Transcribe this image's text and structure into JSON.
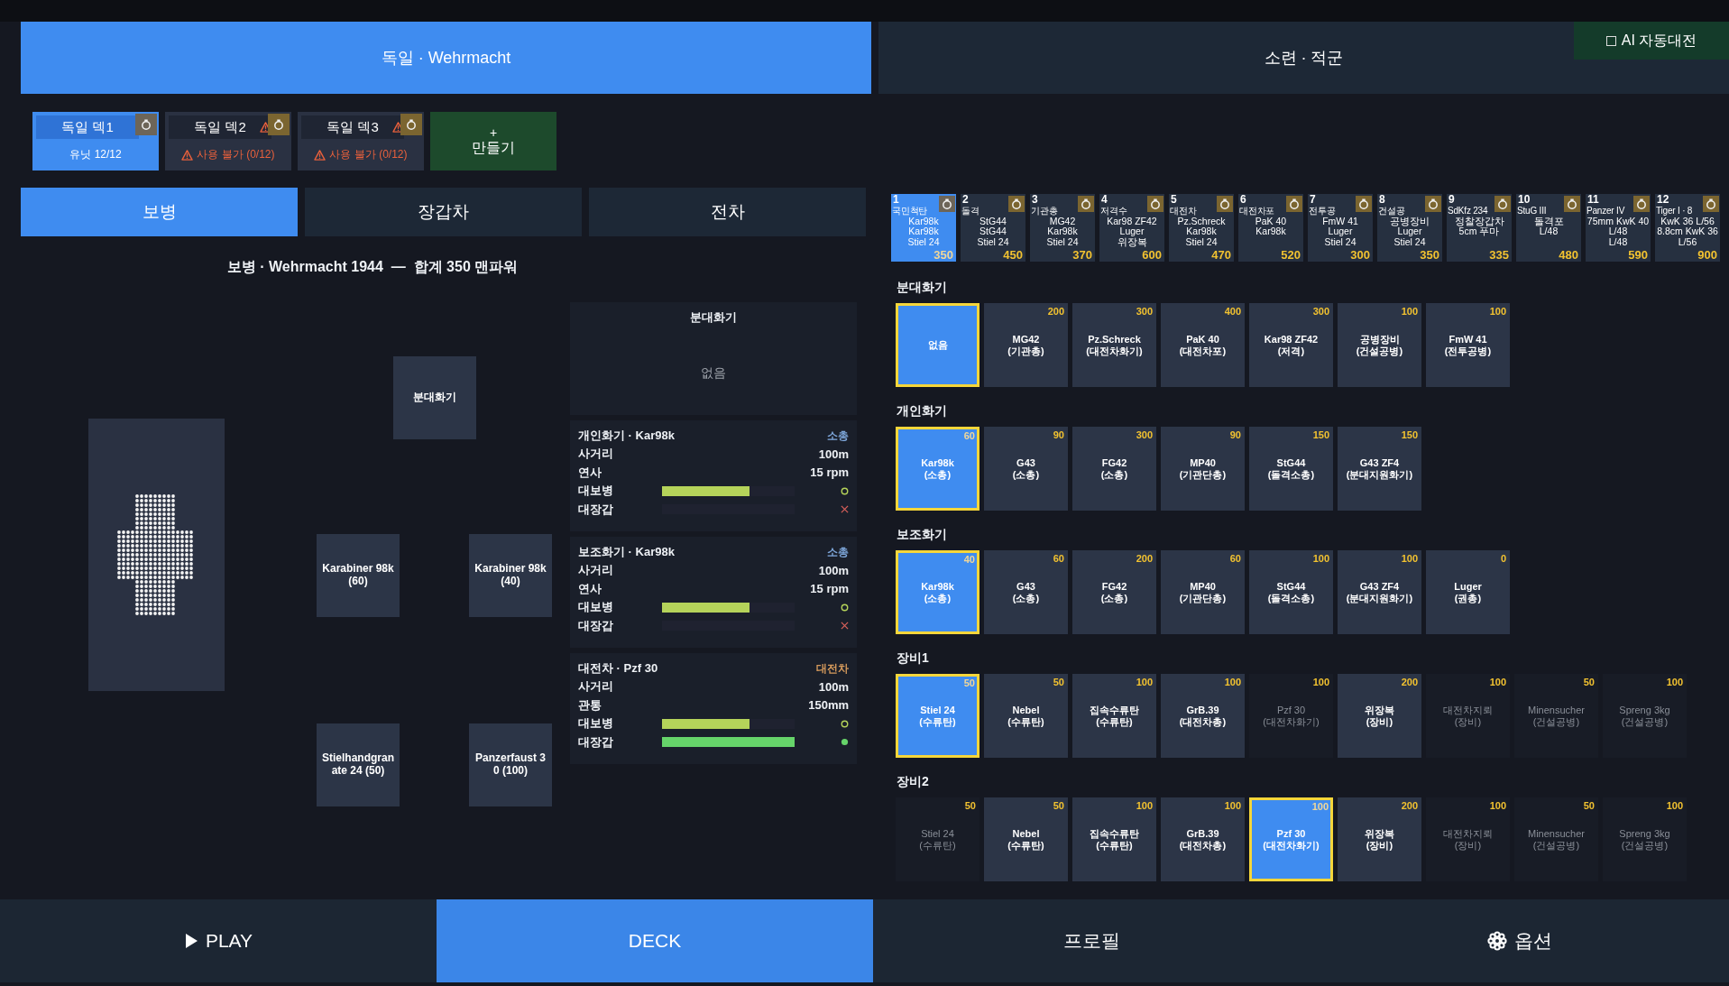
{
  "factions": [
    {
      "label": "독일 · Wehrmacht",
      "selected": true
    },
    {
      "label": "소련 · 적군",
      "selected": false
    }
  ],
  "ai_auto": {
    "label": "AI 자동대전",
    "checked": false
  },
  "decks": [
    {
      "name": "독일 덱1",
      "status": "유닛 12/12",
      "warning": false,
      "selected": true
    },
    {
      "name": "독일 덱2",
      "status": "사용 불가 (0/12)",
      "warning": true,
      "selected": false
    },
    {
      "name": "독일 덱3",
      "status": "사용 불가 (0/12)",
      "warning": true,
      "selected": false
    }
  ],
  "new_deck": {
    "plus": "+",
    "label": "만들기"
  },
  "unit_tabs": [
    {
      "label": "보병",
      "selected": true
    },
    {
      "label": "장갑차",
      "selected": false
    },
    {
      "label": "전차",
      "selected": false
    }
  ],
  "summary": "보병 · Wehrmacht 1944  —  합계 350 맨파워",
  "squad": {
    "rows": [
      [
        {
          "label": "분대화기"
        }
      ],
      [
        {
          "label": "Karabiner 98k (60)"
        },
        {
          "label": "Karabiner 98k (40)"
        }
      ],
      [
        {
          "label": "Stielhandgranate 24 (50)"
        },
        {
          "label": "Panzerfaust 30 (100)"
        }
      ]
    ]
  },
  "squad_weapon_panel": {
    "title": "분대화기",
    "empty_text": "없음"
  },
  "weapon_cards": [
    {
      "title": "개인화기 · Kar98k",
      "class": "소총",
      "color": "#7fa8dc",
      "stats": [
        {
          "kind": "text",
          "label": "사거리",
          "value": "100m"
        },
        {
          "kind": "text",
          "label": "연사",
          "value": "15 rpm"
        },
        {
          "kind": "bar",
          "label": "대보병",
          "level": 0.66,
          "color": "#b5d35a"
        },
        {
          "kind": "bar",
          "label": "대장갑",
          "level": 0,
          "color": "#d8605a"
        }
      ]
    },
    {
      "title": "보조화기 · Kar98k",
      "class": "소총",
      "color": "#7fa8dc",
      "stats": [
        {
          "kind": "text",
          "label": "사거리",
          "value": "100m"
        },
        {
          "kind": "text",
          "label": "연사",
          "value": "15 rpm"
        },
        {
          "kind": "bar",
          "label": "대보병",
          "level": 0.66,
          "color": "#b5d35a"
        },
        {
          "kind": "bar",
          "label": "대장갑",
          "level": 0,
          "color": "#d8605a"
        }
      ]
    },
    {
      "title": "대전차 · Pzf 30",
      "class": "대전차",
      "color": "#d59a5c",
      "stats": [
        {
          "kind": "text",
          "label": "사거리",
          "value": "100m"
        },
        {
          "kind": "text",
          "label": "관통",
          "value": "150mm"
        },
        {
          "kind": "bar",
          "label": "대보병",
          "level": 0.66,
          "color": "#b5d35a"
        },
        {
          "kind": "bar",
          "label": "대장갑",
          "level": 1,
          "color": "#66d46a"
        }
      ]
    }
  ],
  "unit_strip": [
    {
      "index": "1",
      "lines": [
        "국민척탄",
        "Kar98k",
        "Kar98k",
        "Stiel 24"
      ],
      "cost": "350",
      "selected": true
    },
    {
      "index": "2",
      "lines": [
        "돌격",
        "StG44",
        "StG44",
        "Stiel 24"
      ],
      "cost": "450",
      "selected": false
    },
    {
      "index": "3",
      "lines": [
        "기관총",
        "MG42",
        "Kar98k",
        "Stiel 24"
      ],
      "cost": "370",
      "selected": false
    },
    {
      "index": "4",
      "lines": [
        "저격수",
        "Kar98 ZF42",
        "Luger",
        "위장복"
      ],
      "cost": "600",
      "selected": false
    },
    {
      "index": "5",
      "lines": [
        "대전차",
        "Pz.Schreck",
        "Kar98k",
        "Stiel 24"
      ],
      "cost": "470",
      "selected": false
    },
    {
      "index": "6",
      "lines": [
        "대전차포",
        "PaK 40",
        "Kar98k"
      ],
      "cost": "520",
      "selected": false
    },
    {
      "index": "7",
      "lines": [
        "전투공",
        "FmW 41",
        "Luger",
        "Stiel 24"
      ],
      "cost": "300",
      "selected": false
    },
    {
      "index": "8",
      "lines": [
        "건설공",
        "공병장비",
        "Luger",
        "Stiel 24"
      ],
      "cost": "350",
      "selected": false
    },
    {
      "index": "9",
      "lines": [
        "SdKfz 234",
        "정찰장갑차",
        "5cm 푸마"
      ],
      "cost": "335",
      "selected": false
    },
    {
      "index": "10",
      "lines": [
        "StuG III",
        "돌격포",
        "L/48"
      ],
      "cost": "480",
      "selected": false
    },
    {
      "index": "11",
      "lines": [
        "Panzer IV",
        "75mm KwK 40",
        "L/48",
        "L/48"
      ],
      "cost": "590",
      "selected": false
    },
    {
      "index": "12",
      "lines": [
        "Tiger I · 8",
        "KwK 36 L/56",
        "8.8cm KwK 36",
        "L/56"
      ],
      "cost": "900",
      "selected": false
    }
  ],
  "weapon_sections": [
    {
      "title": "분대화기",
      "items": [
        {
          "name": "없음",
          "selected": true,
          "disabled": false
        },
        {
          "name": "MG42",
          "type": "(기관총)",
          "cost": "200",
          "selected": false,
          "disabled": false
        },
        {
          "name": "Pz.Schreck",
          "type": "(대전차화기)",
          "cost": "300",
          "selected": false,
          "disabled": false
        },
        {
          "name": "PaK 40",
          "type": "(대전차포)",
          "cost": "400",
          "selected": false,
          "disabled": false
        },
        {
          "name": "Kar98 ZF42",
          "type": "(저격)",
          "cost": "300",
          "selected": false,
          "disabled": false
        },
        {
          "name": "공병장비",
          "type": "(건설공병)",
          "cost": "100",
          "selected": false,
          "disabled": false
        },
        {
          "name": "FmW 41",
          "type": "(전투공병)",
          "cost": "100",
          "selected": false,
          "disabled": false
        }
      ]
    },
    {
      "title": "개인화기",
      "items": [
        {
          "name": "Kar98k",
          "type": "(소총)",
          "cost": "60",
          "selected": true,
          "disabled": false
        },
        {
          "name": "G43",
          "type": "(소총)",
          "cost": "90",
          "selected": false,
          "disabled": false
        },
        {
          "name": "FG42",
          "type": "(소총)",
          "cost": "300",
          "selected": false,
          "disabled": false
        },
        {
          "name": "MP40",
          "type": "(기관단총)",
          "cost": "90",
          "selected": false,
          "disabled": false
        },
        {
          "name": "StG44",
          "type": "(돌격소총)",
          "cost": "150",
          "selected": false,
          "disabled": false
        },
        {
          "name": "G43 ZF4",
          "type": "(분대지원화기)",
          "cost": "150",
          "selected": false,
          "disabled": false
        }
      ]
    },
    {
      "title": "보조화기",
      "items": [
        {
          "name": "Kar98k",
          "type": "(소총)",
          "cost": "40",
          "selected": true,
          "disabled": false
        },
        {
          "name": "G43",
          "type": "(소총)",
          "cost": "60",
          "selected": false,
          "disabled": false
        },
        {
          "name": "FG42",
          "type": "(소총)",
          "cost": "200",
          "selected": false,
          "disabled": false
        },
        {
          "name": "MP40",
          "type": "(기관단총)",
          "cost": "60",
          "selected": false,
          "disabled": false
        },
        {
          "name": "StG44",
          "type": "(돌격소총)",
          "cost": "100",
          "selected": false,
          "disabled": false
        },
        {
          "name": "G43 ZF4",
          "type": "(분대지원화기)",
          "cost": "100",
          "selected": false,
          "disabled": false
        },
        {
          "name": "Luger",
          "type": "(권총)",
          "cost": "0",
          "selected": false,
          "disabled": false
        }
      ]
    },
    {
      "title": "장비1",
      "items": [
        {
          "name": "Stiel 24",
          "type": "(수류탄)",
          "cost": "50",
          "selected": true,
          "disabled": false
        },
        {
          "name": "Nebel",
          "type": "(수류탄)",
          "cost": "50",
          "selected": false,
          "disabled": false
        },
        {
          "name": "집속수류탄",
          "type": "(수류탄)",
          "cost": "100",
          "selected": false,
          "disabled": false
        },
        {
          "name": "GrB.39",
          "type": "(대전차총)",
          "cost": "100",
          "selected": false,
          "disabled": false
        },
        {
          "name": "Pzf 30",
          "type": "(대전차화기)",
          "cost": "100",
          "selected": false,
          "disabled": true
        },
        {
          "name": "위장복",
          "type": "(장비)",
          "cost": "200",
          "selected": false,
          "disabled": false
        },
        {
          "name": "대전차지뢰",
          "type": "(장비)",
          "cost": "100",
          "selected": false,
          "disabled": true
        },
        {
          "name": "Minensucher",
          "type": "(건설공병)",
          "cost": "50",
          "selected": false,
          "disabled": true
        },
        {
          "name": "Spreng 3kg",
          "type": "(건설공병)",
          "cost": "100",
          "selected": false,
          "disabled": true
        }
      ]
    },
    {
      "title": "장비2",
      "items": [
        {
          "name": "Stiel 24",
          "type": "(수류탄)",
          "cost": "50",
          "selected": false,
          "disabled": true
        },
        {
          "name": "Nebel",
          "type": "(수류탄)",
          "cost": "50",
          "selected": false,
          "disabled": false
        },
        {
          "name": "집속수류탄",
          "type": "(수류탄)",
          "cost": "100",
          "selected": false,
          "disabled": false
        },
        {
          "name": "GrB.39",
          "type": "(대전차총)",
          "cost": "100",
          "selected": false,
          "disabled": false
        },
        {
          "name": "Pzf 30",
          "type": "(대전차화기)",
          "cost": "100",
          "selected": true,
          "disabled": false
        },
        {
          "name": "위장복",
          "type": "(장비)",
          "cost": "200",
          "selected": false,
          "disabled": false
        },
        {
          "name": "대전차지뢰",
          "type": "(장비)",
          "cost": "100",
          "selected": false,
          "disabled": true
        },
        {
          "name": "Minensucher",
          "type": "(건설공병)",
          "cost": "50",
          "selected": false,
          "disabled": true
        },
        {
          "name": "Spreng 3kg",
          "type": "(건설공병)",
          "cost": "100",
          "selected": false,
          "disabled": true
        }
      ]
    }
  ],
  "bottom_nav": [
    {
      "label": "PLAY",
      "kind": "play",
      "selected": false
    },
    {
      "label": "DECK",
      "kind": "plain",
      "selected": true
    },
    {
      "label": "프로필",
      "kind": "plain",
      "selected": false
    },
    {
      "label": "옵션",
      "kind": "settings",
      "selected": false
    }
  ]
}
